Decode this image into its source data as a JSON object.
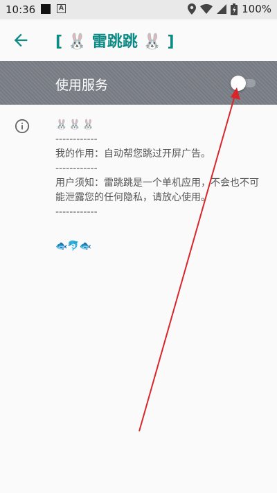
{
  "status_bar": {
    "time": "10:36",
    "battery": "100%"
  },
  "app_bar": {
    "title": "[ 🐰 雷跳跳 🐰 ]"
  },
  "service": {
    "label": "使用服务",
    "enabled": false
  },
  "info": {
    "emoji_line": "🐰🐰🐰",
    "separator1": "------------",
    "purpose": "我的作用：自动帮您跳过开屏广告。",
    "separator2": "------------",
    "notice": "用户须知：雷跳跳是一个单机应用，不会也不可能泄露您的任何隐私，请放心使用。",
    "separator3": "------------",
    "fish_line": "🐟🐬🐟"
  },
  "colors": {
    "accent": "#0c8a84",
    "service_bar": "#7a7e86",
    "annotation_arrow": "#d9262a"
  }
}
